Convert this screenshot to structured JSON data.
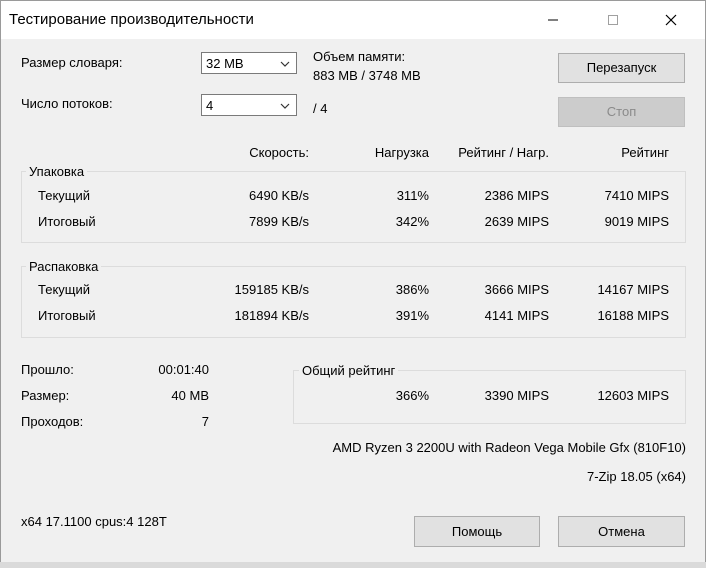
{
  "window": {
    "title": "Тестирование производительности"
  },
  "settings": {
    "dict_label": "Размер словаря:",
    "dict_value": "32 MB",
    "threads_label": "Число потоков:",
    "threads_value": "4",
    "threads_max": "/ 4",
    "memory_label": "Объем памяти:",
    "memory_value": "883 MB / 3748 MB"
  },
  "buttons": {
    "restart": "Перезапуск",
    "stop": "Стоп",
    "help": "Помощь",
    "cancel": "Отмена"
  },
  "columns": {
    "speed": "Скорость:",
    "load": "Нагрузка",
    "rating_per_load": "Рейтинг / Нагр.",
    "rating": "Рейтинг"
  },
  "compress": {
    "title": "Упаковка",
    "rows": [
      {
        "label": "Текущий",
        "speed": "6490 KB/s",
        "load": "311%",
        "rpl": "2386 MIPS",
        "rating": "7410 MIPS"
      },
      {
        "label": "Итоговый",
        "speed": "7899 KB/s",
        "load": "342%",
        "rpl": "2639 MIPS",
        "rating": "9019 MIPS"
      }
    ]
  },
  "decompress": {
    "title": "Распаковка",
    "rows": [
      {
        "label": "Текущий",
        "speed": "159185 KB/s",
        "load": "386%",
        "rpl": "3666 MIPS",
        "rating": "14167 MIPS"
      },
      {
        "label": "Итоговый",
        "speed": "181894 KB/s",
        "load": "391%",
        "rpl": "4141 MIPS",
        "rating": "16188 MIPS"
      }
    ]
  },
  "stats": {
    "elapsed_label": "Прошло:",
    "elapsed_value": "00:01:40",
    "size_label": "Размер:",
    "size_value": "40 MB",
    "passes_label": "Проходов:",
    "passes_value": "7"
  },
  "total": {
    "title": "Общий рейтинг",
    "load": "366%",
    "rpl": "3390 MIPS",
    "rating": "12603 MIPS"
  },
  "info": {
    "cpu": "AMD Ryzen 3 2200U with Radeon Vega Mobile Gfx  (810F10)",
    "version": "7-Zip 18.05 (x64)",
    "sysinfo": "x64 17.1100 cpus:4 128T"
  },
  "icons": {
    "minimize": "minimize-icon",
    "maximize": "maximize-icon",
    "close": "close-icon",
    "dropdown": "chevron-down-icon"
  }
}
